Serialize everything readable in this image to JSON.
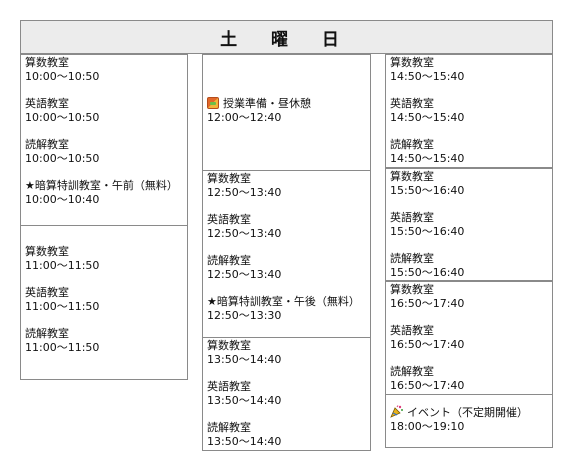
{
  "header": {
    "title": "土 曜 日"
  },
  "columns": [
    {
      "blocks": [
        {
          "entries": [
            {
              "name": "算数教室",
              "time": "10:00〜10:50"
            },
            {
              "name": "英語教室",
              "time": "10:00〜10:50"
            },
            {
              "name": "読解教室",
              "time": "10:00〜10:50"
            },
            {
              "name": "★暗算特訓教室・午前（無料）",
              "time": "10:00〜10:40"
            }
          ]
        },
        {
          "entries": [
            {
              "name": "算数教室",
              "time": "11:00〜11:50"
            },
            {
              "name": "英語教室",
              "time": "11:00〜11:50"
            },
            {
              "name": "読解教室",
              "time": "11:00〜11:50"
            }
          ]
        }
      ]
    },
    {
      "blocks": [
        {
          "entries": [
            {
              "name": "授業準備・昼休憩",
              "time": "12:00〜12:40",
              "icon": "lunch-box-icon"
            }
          ]
        },
        {
          "entries": [
            {
              "name": "算数教室",
              "time": "12:50〜13:40"
            },
            {
              "name": "英語教室",
              "time": "12:50〜13:40"
            },
            {
              "name": "読解教室",
              "time": "12:50〜13:40"
            },
            {
              "name": "★暗算特訓教室・午後（無料）",
              "time": "12:50〜13:30"
            }
          ]
        },
        {
          "entries": [
            {
              "name": "算数教室",
              "time": "13:50〜14:40"
            },
            {
              "name": "英語教室",
              "time": "13:50〜14:40"
            },
            {
              "name": "読解教室",
              "time": "13:50〜14:40"
            }
          ]
        }
      ]
    },
    {
      "blocks": [
        {
          "entries": [
            {
              "name": "算数教室",
              "time": "14:50〜15:40"
            },
            {
              "name": "英語教室",
              "time": "14:50〜15:40"
            },
            {
              "name": "読解教室",
              "time": "14:50〜15:40"
            }
          ]
        },
        {
          "entries": [
            {
              "name": "算数教室",
              "time": "15:50〜16:40"
            },
            {
              "name": "英語教室",
              "time": "15:50〜16:40"
            },
            {
              "name": "読解教室",
              "time": "15:50〜16:40"
            }
          ]
        },
        {
          "entries": [
            {
              "name": "算数教室",
              "time": "16:50〜17:40"
            },
            {
              "name": "英語教室",
              "time": "16:50〜17:40"
            },
            {
              "name": "読解教室",
              "time": "16:50〜17:40"
            }
          ]
        },
        {
          "entries": [
            {
              "name": "イベント（不定期開催）",
              "time": "18:00〜19:10",
              "icon": "party-popper-icon"
            }
          ]
        }
      ]
    }
  ]
}
